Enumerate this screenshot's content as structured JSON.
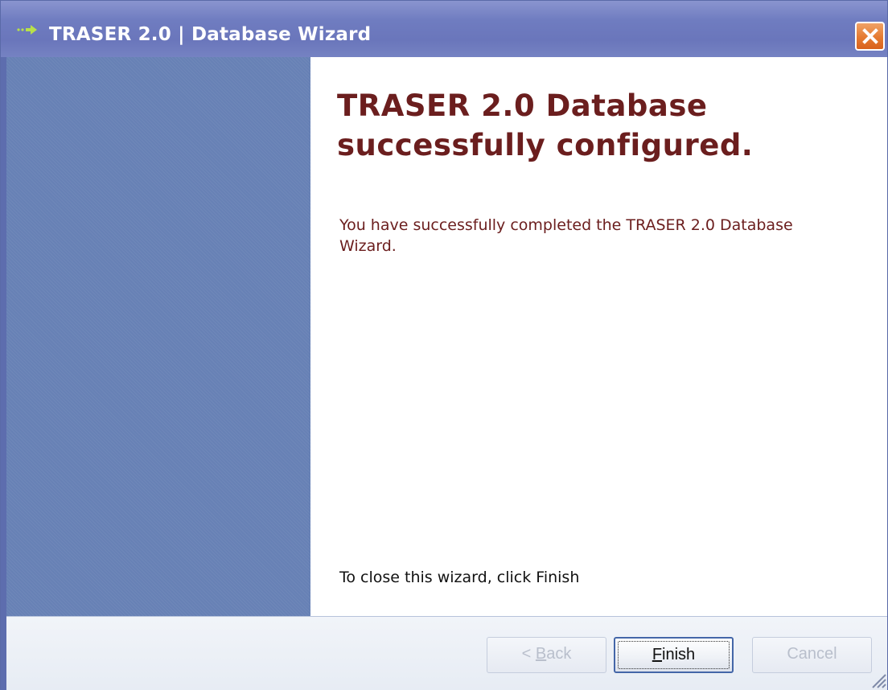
{
  "window": {
    "title": "TRASER 2.0 | Database Wizard",
    "icon": "green-arrow-icon",
    "close_icon": "close-icon"
  },
  "content": {
    "heading": "TRASER 2.0 Database successfully configured.",
    "description": "You have successfully completed the TRASER 2.0 Database Wizard.",
    "close_hint": "To close this wizard, click Finish"
  },
  "buttons": {
    "back": {
      "label_prefix": "< ",
      "label_mnemonic": "B",
      "label_rest": "ack",
      "enabled": false
    },
    "finish": {
      "label_mnemonic": "F",
      "label_rest": "inish",
      "enabled": true
    },
    "cancel": {
      "label": "Cancel",
      "enabled": false
    }
  },
  "colors": {
    "titlebar": "#6f7cc0",
    "sidebar": "#6781b5",
    "heading_text": "#6b1e1e",
    "close_button": "#e57a30"
  }
}
